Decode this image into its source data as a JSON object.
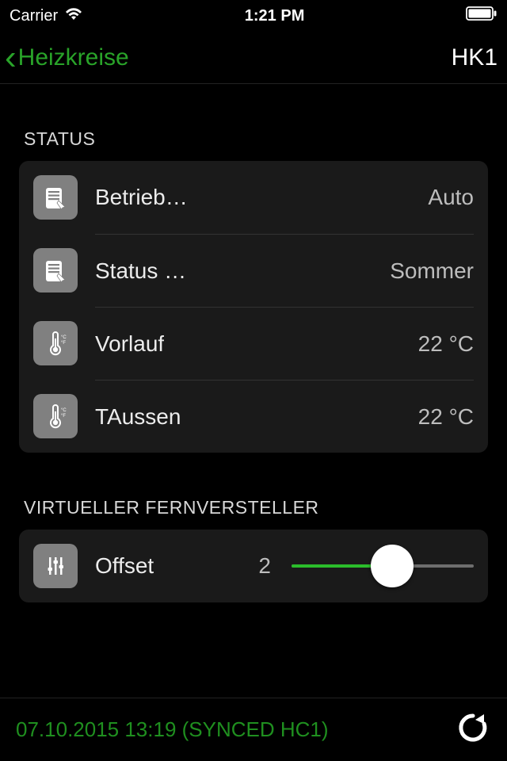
{
  "status_bar": {
    "carrier": "Carrier",
    "time": "1:21 PM"
  },
  "nav": {
    "back_label": "Heizkreise",
    "title": "HK1"
  },
  "sections": {
    "status": {
      "header": "STATUS",
      "rows": [
        {
          "icon": "list-tap",
          "label": "Betrieb…",
          "value": "Auto"
        },
        {
          "icon": "list-tap",
          "label": "Status …",
          "value": "Sommer"
        },
        {
          "icon": "thermometer",
          "label": "Vorlauf",
          "value": "22 °C"
        },
        {
          "icon": "thermometer",
          "label": "TAussen",
          "value": "22 °C"
        }
      ]
    },
    "remote": {
      "header": "VIRTUELLER FERNVERSTELLER",
      "row": {
        "icon": "sliders",
        "label": "Offset",
        "value": "2",
        "slider_percent": 55
      }
    }
  },
  "footer": {
    "sync_text": "07.10.2015 13:19 (SYNCED HC1)"
  }
}
